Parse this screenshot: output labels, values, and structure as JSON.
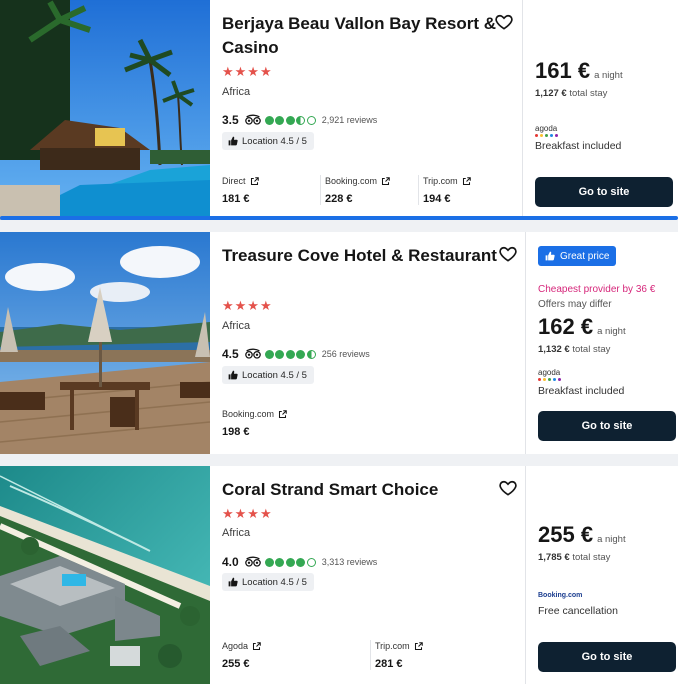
{
  "hotels": [
    {
      "name": "Berjaya Beau Vallon Bay Resort & Casino",
      "stars": "★★★★",
      "region": "Africa",
      "rating": "3.5",
      "reviews": "2,921 reviews",
      "location": "Location 4.5 / 5",
      "providers": [
        {
          "name": "Direct",
          "price": "181 €"
        },
        {
          "name": "Booking.com",
          "price": "228 €"
        },
        {
          "name": "Trip.com",
          "price": "194 €"
        }
      ],
      "price": "161 €",
      "per_night": "a night",
      "total_amount": "1,127 €",
      "total_label": "total stay",
      "logo": "agoda",
      "perk": "Breakfast included",
      "cta": "Go to site"
    },
    {
      "name": "Treasure Cove Hotel & Restaurant",
      "stars": "★★★★",
      "region": "Africa",
      "rating": "4.5",
      "reviews": "256 reviews",
      "location": "Location 4.5 / 5",
      "providers": [
        {
          "name": "Booking.com",
          "price": "198 €"
        }
      ],
      "badge": "Great price",
      "cheapest": "Cheapest provider by 36 €",
      "offers_note": "Offers may differ",
      "price": "162 €",
      "per_night": "a night",
      "total_amount": "1,132 €",
      "total_label": "total stay",
      "logo": "agoda",
      "perk": "Breakfast included",
      "cta": "Go to site"
    },
    {
      "name": "Coral Strand Smart Choice",
      "stars": "★★★★",
      "region": "Africa",
      "rating": "4.0",
      "reviews": "3,313 reviews",
      "location": "Location 4.5 / 5",
      "providers": [
        {
          "name": "Agoda",
          "price": "255 €"
        },
        {
          "name": "Trip.com",
          "price": "281 €"
        }
      ],
      "price": "255 €",
      "per_night": "a night",
      "total_amount": "1,785 €",
      "total_label": "total stay",
      "logo": "Booking.com",
      "perk": "Free cancellation",
      "cta": "Go to site"
    }
  ],
  "colors": {
    "accent": "#1b6fe6",
    "cta": "#0e2131",
    "stars": "#e4524b",
    "rating_dots": "#34a853",
    "cheapest": "#d6277b"
  },
  "icons": {
    "favorite": "heart-outline-icon",
    "rating_source": "tripadvisor-owl-icon",
    "location": "thumbs-up-icon",
    "provider_link": "external-link-icon",
    "badge": "thumbs-up-icon"
  }
}
